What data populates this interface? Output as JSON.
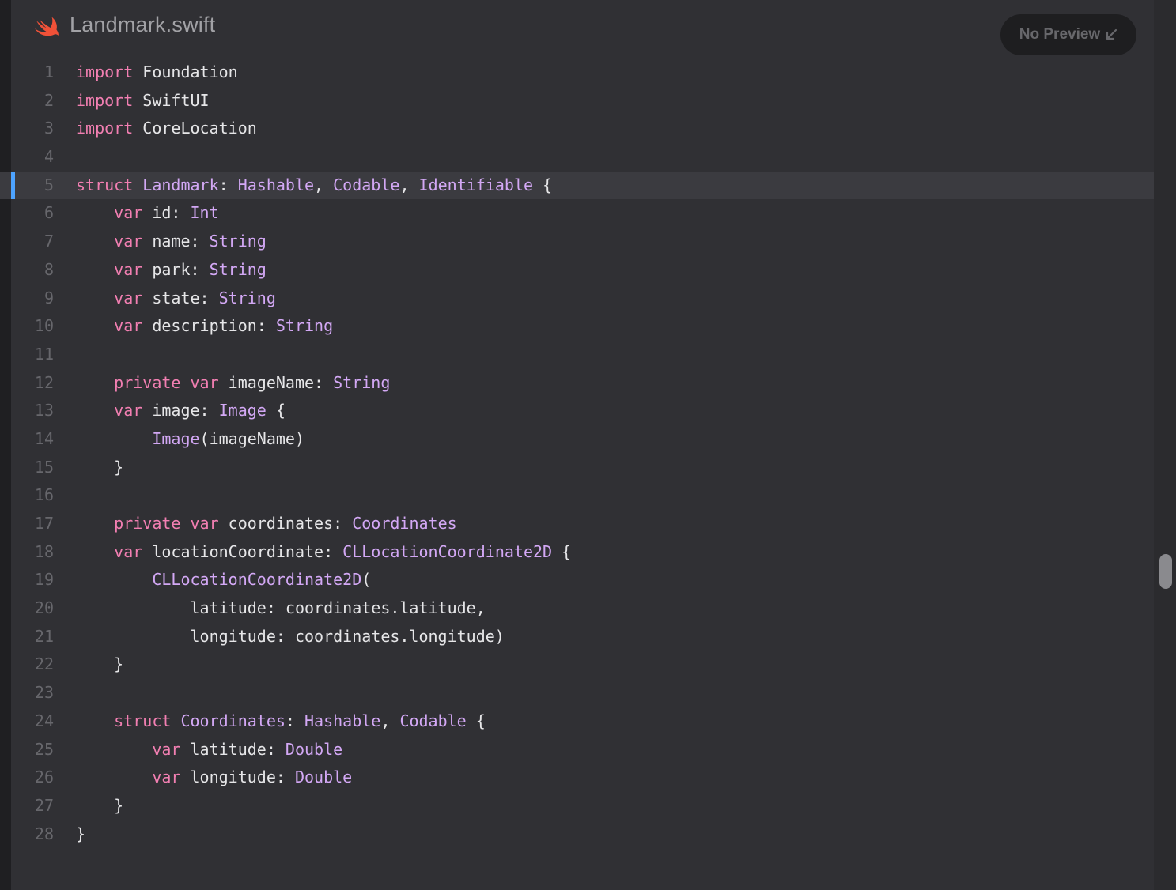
{
  "header": {
    "file_name": "Landmark.swift",
    "file_icon": "swift-logo-icon",
    "preview_button_label": "No Preview",
    "preview_button_icon": "arrow-down-left-icon"
  },
  "colors": {
    "editor_background": "#303034",
    "keyword": "#f27fb2",
    "type": "#d3a8f5",
    "plain_text": "#e6e6e8",
    "line_number": "#67676c",
    "current_line_marker": "#4da3ff",
    "swift_logo": "#f05138"
  },
  "editor": {
    "current_line": 5,
    "lines": [
      {
        "n": "1",
        "tokens": [
          {
            "t": "import",
            "c": "kw"
          },
          {
            "t": " Foundation"
          }
        ]
      },
      {
        "n": "2",
        "tokens": [
          {
            "t": "import",
            "c": "kw"
          },
          {
            "t": " SwiftUI"
          }
        ]
      },
      {
        "n": "3",
        "tokens": [
          {
            "t": "import",
            "c": "kw"
          },
          {
            "t": " CoreLocation"
          }
        ]
      },
      {
        "n": "4",
        "tokens": []
      },
      {
        "n": "5",
        "tokens": [
          {
            "t": "struct",
            "c": "kw"
          },
          {
            "t": " "
          },
          {
            "t": "Landmark",
            "c": "ty"
          },
          {
            "t": ": "
          },
          {
            "t": "Hashable",
            "c": "ty"
          },
          {
            "t": ", "
          },
          {
            "t": "Codable",
            "c": "ty"
          },
          {
            "t": ", "
          },
          {
            "t": "Identifiable",
            "c": "ty"
          },
          {
            "t": " {"
          }
        ]
      },
      {
        "n": "6",
        "tokens": [
          {
            "t": "    "
          },
          {
            "t": "var",
            "c": "kw"
          },
          {
            "t": " id: "
          },
          {
            "t": "Int",
            "c": "ty"
          }
        ]
      },
      {
        "n": "7",
        "tokens": [
          {
            "t": "    "
          },
          {
            "t": "var",
            "c": "kw"
          },
          {
            "t": " name: "
          },
          {
            "t": "String",
            "c": "ty"
          }
        ]
      },
      {
        "n": "8",
        "tokens": [
          {
            "t": "    "
          },
          {
            "t": "var",
            "c": "kw"
          },
          {
            "t": " park: "
          },
          {
            "t": "String",
            "c": "ty"
          }
        ]
      },
      {
        "n": "9",
        "tokens": [
          {
            "t": "    "
          },
          {
            "t": "var",
            "c": "kw"
          },
          {
            "t": " state: "
          },
          {
            "t": "String",
            "c": "ty"
          }
        ]
      },
      {
        "n": "10",
        "tokens": [
          {
            "t": "    "
          },
          {
            "t": "var",
            "c": "kw"
          },
          {
            "t": " description: "
          },
          {
            "t": "String",
            "c": "ty"
          }
        ]
      },
      {
        "n": "11",
        "tokens": []
      },
      {
        "n": "12",
        "tokens": [
          {
            "t": "    "
          },
          {
            "t": "private",
            "c": "kw"
          },
          {
            "t": " "
          },
          {
            "t": "var",
            "c": "kw"
          },
          {
            "t": " imageName: "
          },
          {
            "t": "String",
            "c": "ty"
          }
        ]
      },
      {
        "n": "13",
        "tokens": [
          {
            "t": "    "
          },
          {
            "t": "var",
            "c": "kw"
          },
          {
            "t": " image: "
          },
          {
            "t": "Image",
            "c": "ty"
          },
          {
            "t": " {"
          }
        ]
      },
      {
        "n": "14",
        "tokens": [
          {
            "t": "        "
          },
          {
            "t": "Image",
            "c": "ty"
          },
          {
            "t": "(imageName)"
          }
        ]
      },
      {
        "n": "15",
        "tokens": [
          {
            "t": "    }"
          }
        ]
      },
      {
        "n": "16",
        "tokens": []
      },
      {
        "n": "17",
        "tokens": [
          {
            "t": "    "
          },
          {
            "t": "private",
            "c": "kw"
          },
          {
            "t": " "
          },
          {
            "t": "var",
            "c": "kw"
          },
          {
            "t": " coordinates: "
          },
          {
            "t": "Coordinates",
            "c": "ty"
          }
        ]
      },
      {
        "n": "18",
        "tokens": [
          {
            "t": "    "
          },
          {
            "t": "var",
            "c": "kw"
          },
          {
            "t": " locationCoordinate: "
          },
          {
            "t": "CLLocationCoordinate2D",
            "c": "ty"
          },
          {
            "t": " {"
          }
        ]
      },
      {
        "n": "19",
        "tokens": [
          {
            "t": "        "
          },
          {
            "t": "CLLocationCoordinate2D",
            "c": "ty"
          },
          {
            "t": "("
          }
        ]
      },
      {
        "n": "20",
        "tokens": [
          {
            "t": "            latitude: coordinates.latitude,"
          }
        ]
      },
      {
        "n": "21",
        "tokens": [
          {
            "t": "            longitude: coordinates.longitude)"
          }
        ]
      },
      {
        "n": "22",
        "tokens": [
          {
            "t": "    }"
          }
        ]
      },
      {
        "n": "23",
        "tokens": []
      },
      {
        "n": "24",
        "tokens": [
          {
            "t": "    "
          },
          {
            "t": "struct",
            "c": "kw"
          },
          {
            "t": " "
          },
          {
            "t": "Coordinates",
            "c": "ty"
          },
          {
            "t": ": "
          },
          {
            "t": "Hashable",
            "c": "ty"
          },
          {
            "t": ", "
          },
          {
            "t": "Codable",
            "c": "ty"
          },
          {
            "t": " {"
          }
        ]
      },
      {
        "n": "25",
        "tokens": [
          {
            "t": "        "
          },
          {
            "t": "var",
            "c": "kw"
          },
          {
            "t": " latitude: "
          },
          {
            "t": "Double",
            "c": "ty"
          }
        ]
      },
      {
        "n": "26",
        "tokens": [
          {
            "t": "        "
          },
          {
            "t": "var",
            "c": "kw"
          },
          {
            "t": " longitude: "
          },
          {
            "t": "Double",
            "c": "ty"
          }
        ]
      },
      {
        "n": "27",
        "tokens": [
          {
            "t": "    }"
          }
        ]
      },
      {
        "n": "28",
        "tokens": [
          {
            "t": "}"
          }
        ]
      }
    ]
  }
}
